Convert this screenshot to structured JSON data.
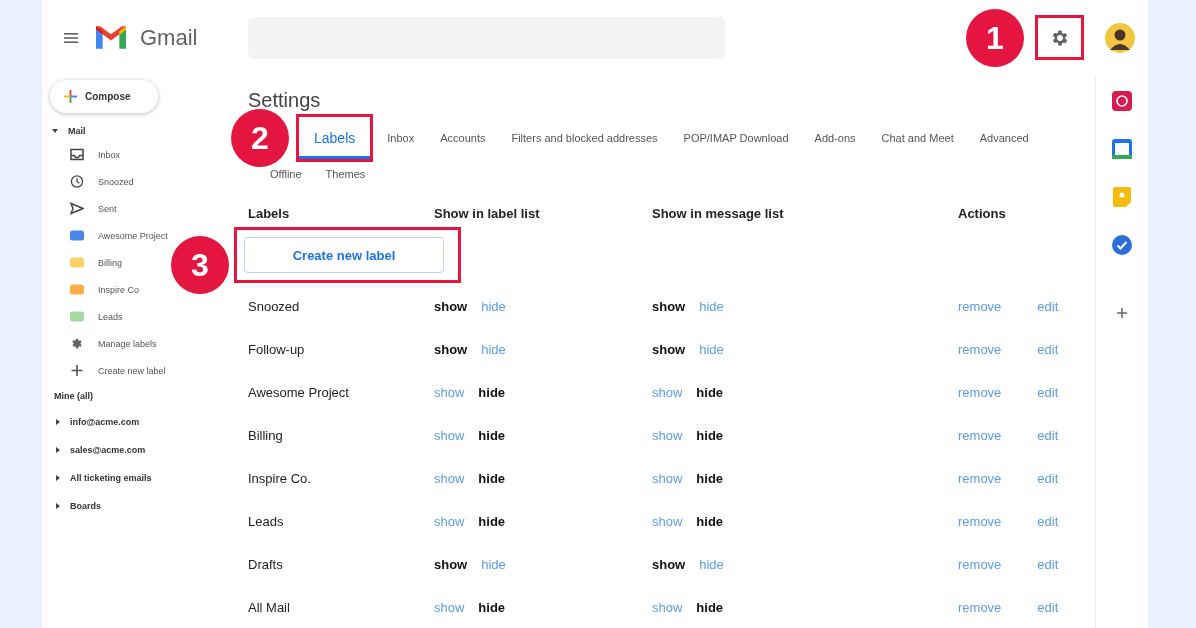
{
  "header": {
    "product": "Gmail",
    "settings": {
      "highlighted": true
    }
  },
  "callouts": [
    {
      "number": "1"
    },
    {
      "number": "2"
    },
    {
      "number": "3"
    }
  ],
  "sidebar": {
    "compose": "Compose",
    "mail": {
      "label": "Mail",
      "expanded": true
    },
    "items": [
      {
        "kind": "inbox",
        "label": "Inbox"
      },
      {
        "kind": "snoozed",
        "label": "Snoozed"
      },
      {
        "kind": "sent",
        "label": "Sent"
      },
      {
        "kind": "label",
        "label": "Awesome Project",
        "color": "#4a86e8"
      },
      {
        "kind": "label",
        "label": "Billing",
        "color": "#fad165"
      },
      {
        "kind": "label",
        "label": "Inspire Co",
        "color": "#ffad47"
      },
      {
        "kind": "label",
        "label": "Leads",
        "color": "#a6d8a6"
      },
      {
        "kind": "manage",
        "label": "Manage labels"
      },
      {
        "kind": "create",
        "label": "Create new label"
      }
    ],
    "section": "Mine (all)",
    "groups": [
      {
        "label": "info@acme.com",
        "expanded": false
      },
      {
        "label": "sales@acme.com",
        "expanded": false
      },
      {
        "label": "All ticketing emails",
        "expanded": false
      },
      {
        "label": "Boards",
        "expanded": false
      }
    ]
  },
  "settings": {
    "title": "Settings",
    "tab_rows": [
      [
        {
          "label": "Labels",
          "selected": true,
          "highlighted": true
        },
        {
          "label": "Inbox",
          "selected": false,
          "highlighted": false
        },
        {
          "label": "Accounts",
          "selected": false,
          "highlighted": false
        },
        {
          "label": "Filters and blocked addresses",
          "selected": false,
          "highlighted": false
        },
        {
          "label": "POP/IMAP Download",
          "selected": false,
          "highlighted": false
        },
        {
          "label": "Add-ons",
          "selected": false,
          "highlighted": false
        },
        {
          "label": "Chat and Meet",
          "selected": false,
          "highlighted": false
        },
        {
          "label": "Advanced",
          "selected": false,
          "highlighted": false
        }
      ],
      [
        {
          "label": "Offline",
          "selected": false,
          "highlighted": false
        },
        {
          "label": "Themes",
          "selected": false,
          "highlighted": false
        }
      ]
    ],
    "table": {
      "columns": [
        "Labels",
        "Show in label list",
        "Show in message list",
        "Actions"
      ],
      "create_button": {
        "label": "Create new label",
        "highlighted": true
      },
      "rows": [
        {
          "name": "Snoozed",
          "label_list": {
            "options": [
              "show",
              "hide"
            ],
            "shown": true
          },
          "message_list": {
            "options": [
              "show",
              "hide"
            ],
            "shown": true
          },
          "actions": [
            "remove",
            "edit"
          ]
        },
        {
          "name": "Follow-up",
          "label_list": {
            "options": [
              "show",
              "hide"
            ],
            "shown": true
          },
          "message_list": {
            "options": [
              "show",
              "hide"
            ],
            "shown": true
          },
          "actions": [
            "remove",
            "edit"
          ]
        },
        {
          "name": "Awesome Project",
          "label_list": {
            "options": [
              "show",
              "hide"
            ],
            "shown": false
          },
          "message_list": {
            "options": [
              "show",
              "hide"
            ],
            "shown": false
          },
          "actions": [
            "remove",
            "edit"
          ]
        },
        {
          "name": "Billing",
          "label_list": {
            "options": [
              "show",
              "hide"
            ],
            "shown": false
          },
          "message_list": {
            "options": [
              "show",
              "hide"
            ],
            "shown": false
          },
          "actions": [
            "remove",
            "edit"
          ]
        },
        {
          "name": "Inspire Co.",
          "label_list": {
            "options": [
              "show",
              "hide"
            ],
            "shown": false
          },
          "message_list": {
            "options": [
              "show",
              "hide"
            ],
            "shown": false
          },
          "actions": [
            "remove",
            "edit"
          ]
        },
        {
          "name": "Leads",
          "label_list": {
            "options": [
              "show",
              "hide"
            ],
            "shown": false
          },
          "message_list": {
            "options": [
              "show",
              "hide"
            ],
            "shown": false
          },
          "actions": [
            "remove",
            "edit"
          ]
        },
        {
          "name": "Drafts",
          "label_list": {
            "options": [
              "show",
              "hide"
            ],
            "shown": true
          },
          "message_list": {
            "options": [
              "show",
              "hide"
            ],
            "shown": true
          },
          "actions": [
            "remove",
            "edit"
          ]
        },
        {
          "name": "All Mail",
          "label_list": {
            "options": [
              "show",
              "hide"
            ],
            "shown": false
          },
          "message_list": {
            "options": [
              "show",
              "hide"
            ],
            "shown": false
          },
          "actions": [
            "remove",
            "edit"
          ]
        }
      ]
    }
  }
}
